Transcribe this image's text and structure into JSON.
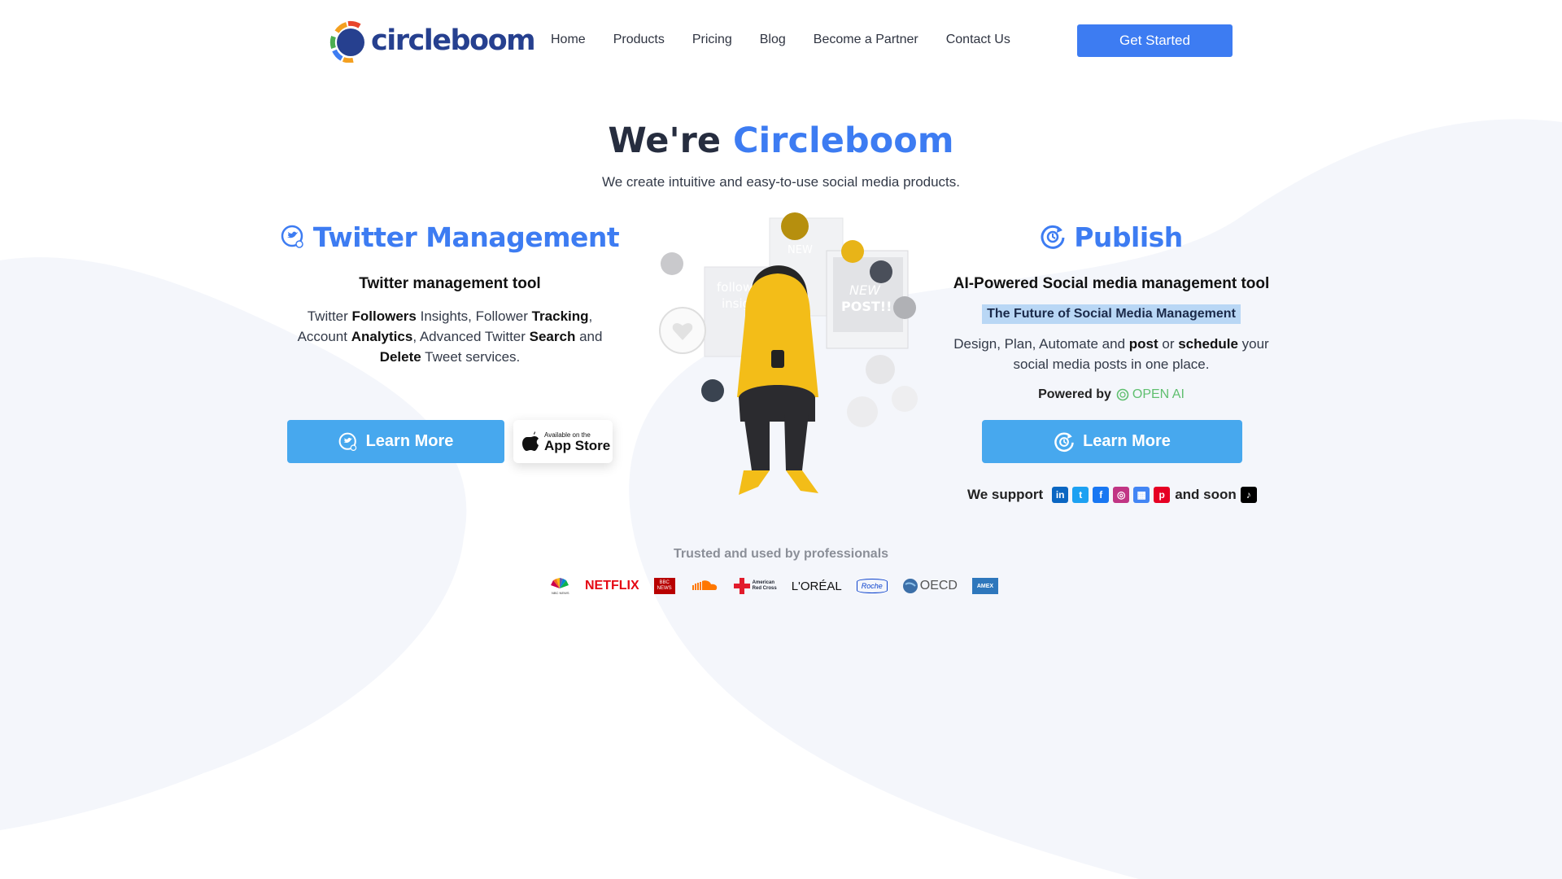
{
  "colors": {
    "accent": "#3d7cf2",
    "brand_dark": "#26408f",
    "learn_button": "#47a8ee",
    "highlight": "#b9d7f5",
    "openai": "#5fbf6f"
  },
  "header": {
    "logo_text": "circleboom",
    "nav": [
      "Home",
      "Products",
      "Pricing",
      "Blog",
      "Become a Partner",
      "Contact Us"
    ],
    "cta_label": "Get Started"
  },
  "hero": {
    "title_prefix": "We're",
    "title_accent": "Circleboom",
    "subtitle": "We create intuitive and easy-to-use social media products."
  },
  "twitter": {
    "icon": "twitter-circle-icon",
    "title": "Twitter Management",
    "subtitle": "Twitter management tool",
    "desc": {
      "p1": "Twitter ",
      "b1": "Followers",
      "p2": " Insights, Follower ",
      "b2": "Tracking",
      "p3": ",",
      "p4": "Account ",
      "b3": "Analytics",
      "p5": ", Advanced Twitter ",
      "b4": "Search",
      "p6": " and",
      "b5": "Delete",
      "p7": " Tweet services."
    },
    "learn_more": "Learn More",
    "appstore_small": "Available on the",
    "appstore_big": "App Store"
  },
  "illustration": {
    "card1": "followers",
    "card2": "insights",
    "card3": "NEW",
    "card4": "POST!!"
  },
  "publish": {
    "icon": "publish-circle-icon",
    "title": "Publish",
    "subtitle_bold": "AI-Powered",
    "subtitle_rest": " Social media management tool",
    "highlight": "The Future of Social Media Management",
    "desc": {
      "p1": "Design, Plan, Automate and ",
      "b1": "post",
      "p2": " or ",
      "b2": "schedule",
      "p3": " your",
      "p4": "social media posts in one place."
    },
    "powered_by": "Powered by",
    "openai": "OPEN AI",
    "learn_more": "Learn More"
  },
  "support": {
    "label": "We support",
    "and_soon": "and soon",
    "networks": [
      "linkedin-icon",
      "twitter-icon",
      "facebook-icon",
      "instagram-icon",
      "google-business-icon",
      "pinterest-icon"
    ],
    "soon": "tiktok-icon"
  },
  "trusted": {
    "label": "Trusted and used by professionals",
    "brands": {
      "nbc": "NBC NEWS",
      "netflix": "NETFLIX",
      "bbc1": "BBC",
      "bbc2": "NEWS",
      "soundcloud": "SOUNDCLOUD",
      "redcross1": "American",
      "redcross2": "Red Cross",
      "loreal": "L'ORÉAL",
      "roche": "Roche",
      "oecd": "OECD",
      "amex": "AMEX"
    }
  }
}
